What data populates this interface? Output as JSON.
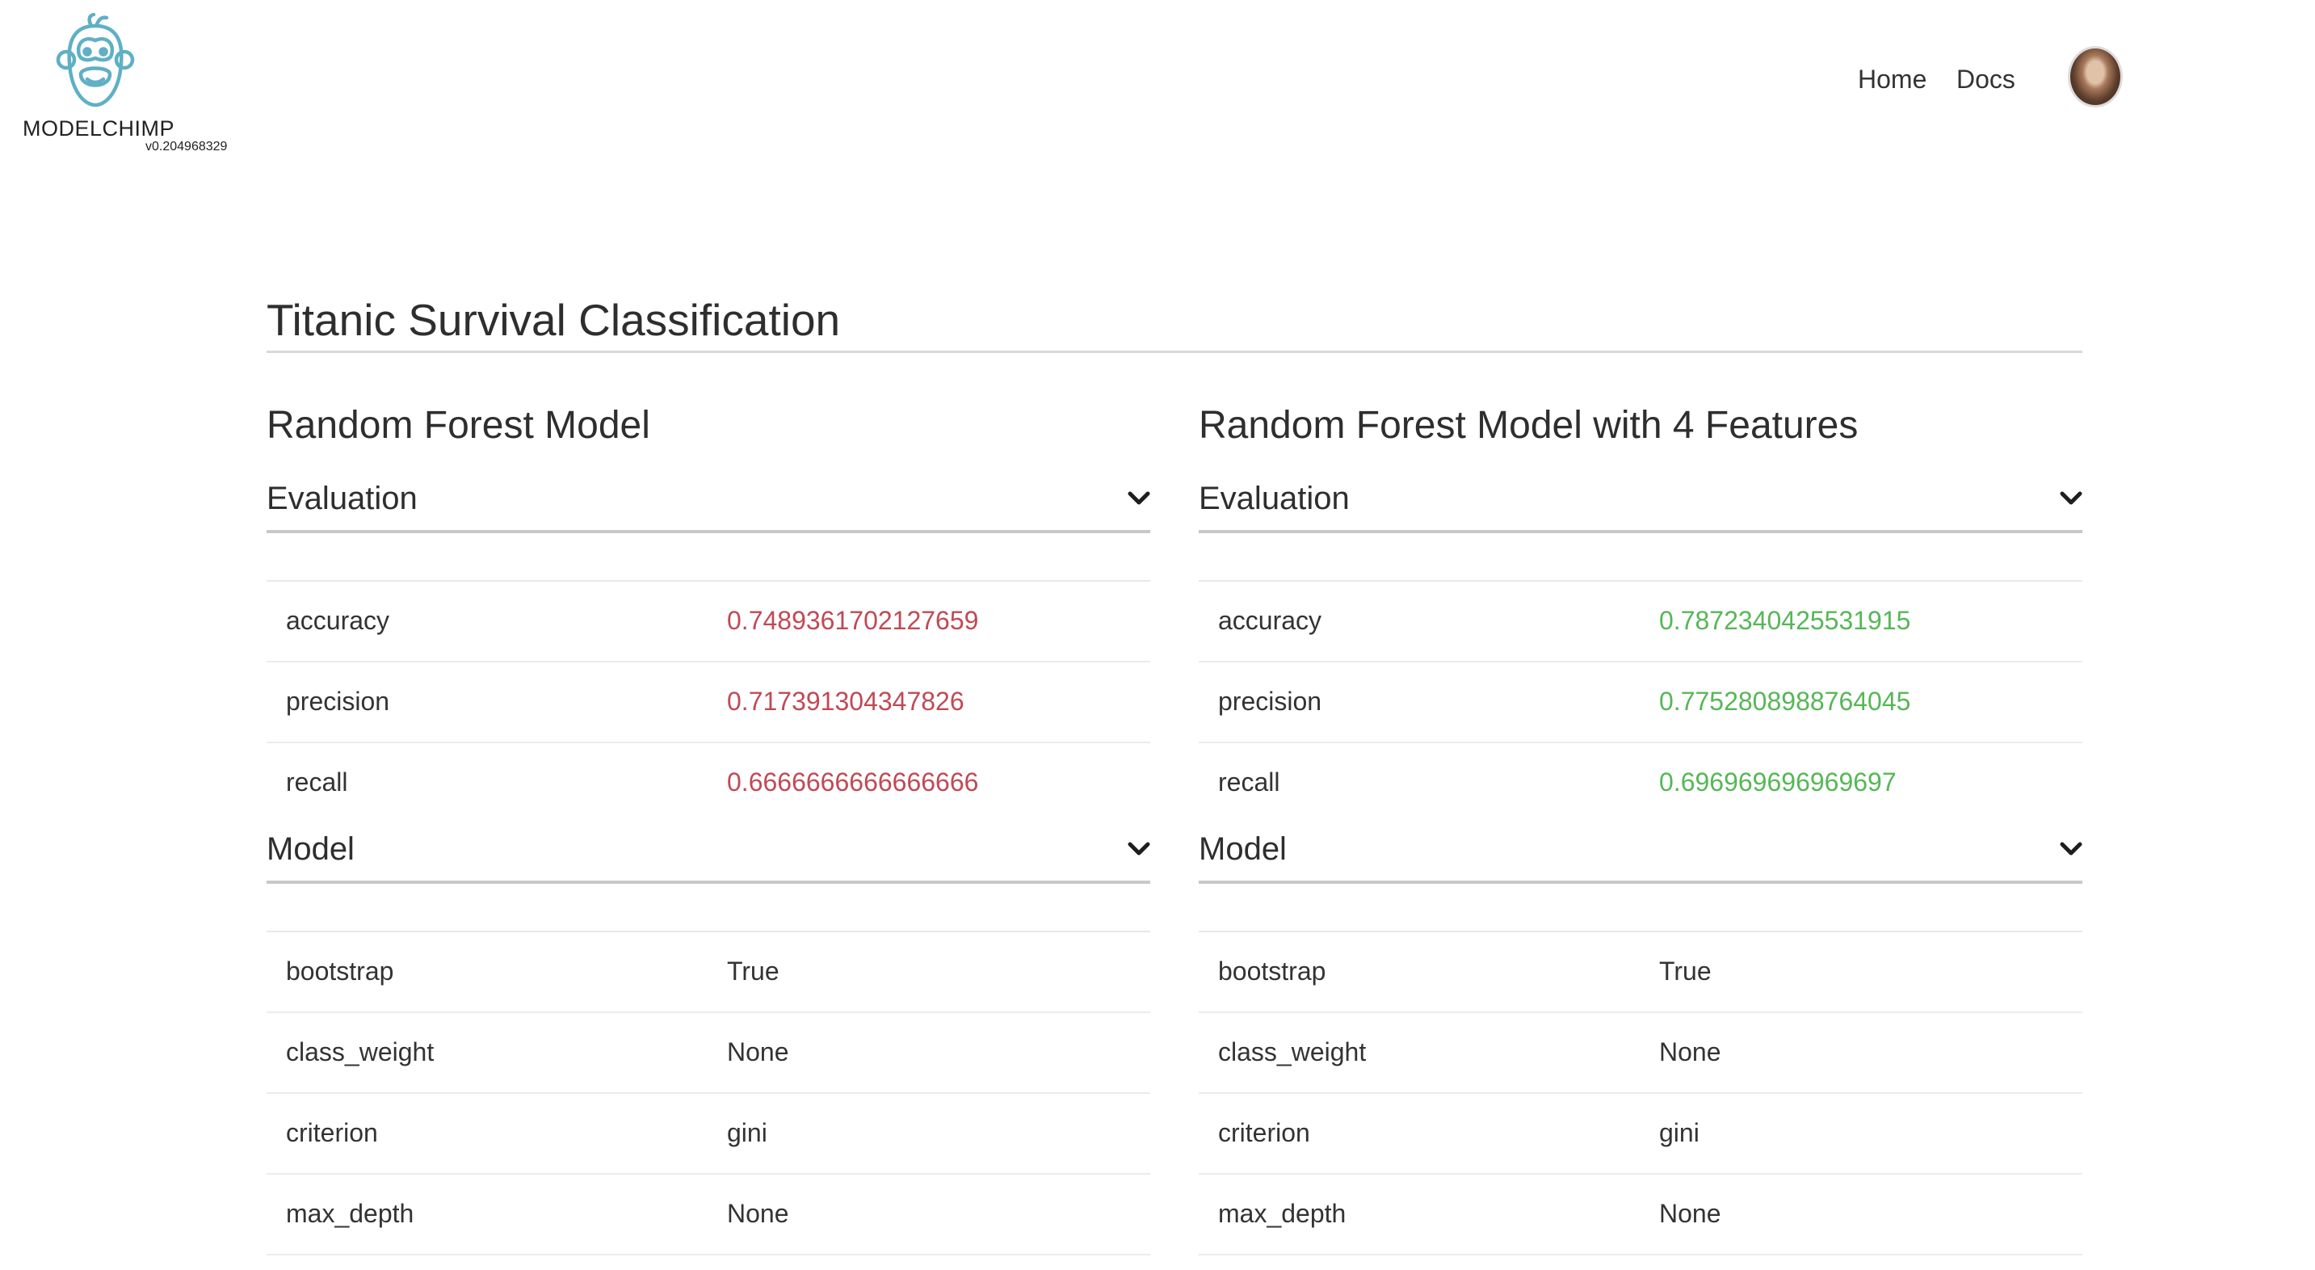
{
  "brand": {
    "name": "MODELCHIMP",
    "version": "v0.204968329",
    "logo_icon": "chimp-logo-icon"
  },
  "nav": {
    "home": "Home",
    "docs": "Docs"
  },
  "page_title": "Titanic Survival Classification",
  "models": [
    {
      "title": "Random Forest Model",
      "evaluation_label": "Evaluation",
      "evaluation": [
        {
          "key": "accuracy",
          "value": "0.7489361702127659"
        },
        {
          "key": "precision",
          "value": "0.717391304347826"
        },
        {
          "key": "recall",
          "value": "0.6666666666666666"
        }
      ],
      "model_label": "Model",
      "params": [
        {
          "key": "bootstrap",
          "value": "True"
        },
        {
          "key": "class_weight",
          "value": "None"
        },
        {
          "key": "criterion",
          "value": "gini"
        },
        {
          "key": "max_depth",
          "value": "None"
        }
      ]
    },
    {
      "title": "Random Forest Model with 4 Features",
      "evaluation_label": "Evaluation",
      "evaluation": [
        {
          "key": "accuracy",
          "value": "0.7872340425531915"
        },
        {
          "key": "precision",
          "value": "0.7752808988764045"
        },
        {
          "key": "recall",
          "value": "0.696969696969697"
        }
      ],
      "model_label": "Model",
      "params": [
        {
          "key": "bootstrap",
          "value": "True"
        },
        {
          "key": "class_weight",
          "value": "None"
        },
        {
          "key": "criterion",
          "value": "gini"
        },
        {
          "key": "max_depth",
          "value": "None"
        }
      ]
    }
  ],
  "colors": {
    "worse_metric": "#c04a55",
    "better_metric": "#56b756",
    "logo": "#5fb0c4"
  }
}
